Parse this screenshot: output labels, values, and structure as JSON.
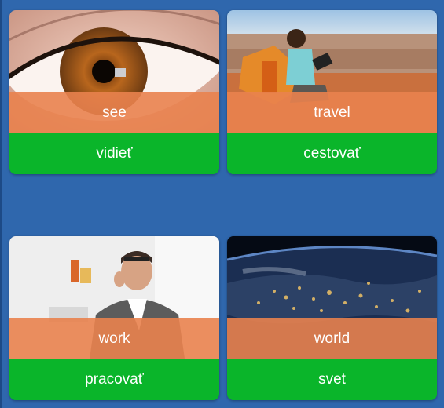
{
  "colors": {
    "background": "#2f67ad",
    "overlay": "#e9824e",
    "translation_bar": "#0ab52a"
  },
  "cards": [
    {
      "word": "see",
      "translation": "vidieť",
      "image": "eye-photo"
    },
    {
      "word": "travel",
      "translation": "cestovať",
      "image": "hiker-canyon-photo"
    },
    {
      "word": "work",
      "translation": "pracovať",
      "image": "man-working-photo"
    },
    {
      "word": "world",
      "translation": "svet",
      "image": "earth-night-photo"
    }
  ]
}
